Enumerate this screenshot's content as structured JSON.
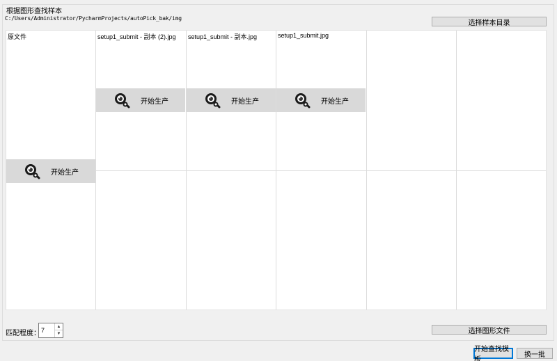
{
  "group": {
    "title": "根据图形查找样本",
    "path": "C:/Users/Administrator/PycharmProjects/autoPick_bak/img",
    "select_dir_button": "选择样本目录"
  },
  "grid": {
    "origin_label": "原文件",
    "images": [
      {
        "name": "setup1_submit - 副本 (2).jpg"
      },
      {
        "name": "setup1_submit - 副本.jpg"
      },
      {
        "name": "setup1_submit.jpg"
      }
    ],
    "produce_label": "开始生产",
    "produce_icon": "gear-search-icon"
  },
  "match": {
    "label": "匹配程度：",
    "value": "7"
  },
  "select_file_button": "选择图形文件",
  "start_search_button": "开始查找模板",
  "next_batch_button": "换一批"
}
